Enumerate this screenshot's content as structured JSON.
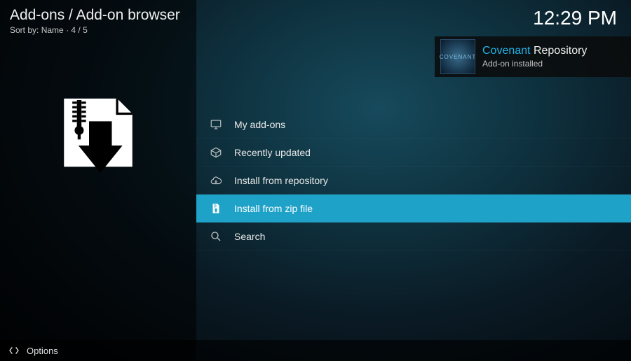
{
  "header": {
    "breadcrumb": "Add-ons / Add-on browser",
    "sort_label": "Sort by:",
    "sort_value": "Name",
    "position": "4 / 5",
    "clock": "12:29 PM"
  },
  "notification": {
    "title_accent": "Covenant",
    "title_rest": " Repository",
    "subtitle": "Add-on installed",
    "icon_text": "COVENANT"
  },
  "menu": {
    "items": [
      {
        "label": "My add-ons",
        "icon": "monitor-icon",
        "selected": false
      },
      {
        "label": "Recently updated",
        "icon": "box-icon",
        "selected": false
      },
      {
        "label": "Install from repository",
        "icon": "cloud-down-icon",
        "selected": false
      },
      {
        "label": "Install from zip file",
        "icon": "zip-icon",
        "selected": true
      },
      {
        "label": "Search",
        "icon": "search-icon",
        "selected": false
      }
    ]
  },
  "footer": {
    "options_label": "Options"
  }
}
